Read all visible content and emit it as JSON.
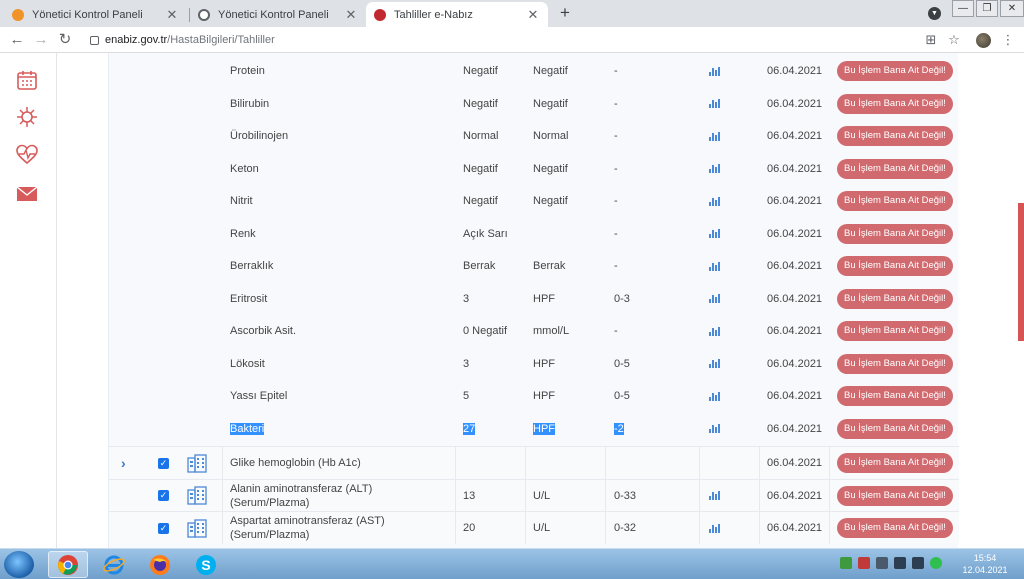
{
  "browser": {
    "tabs": [
      {
        "title": "Yönetici Kontrol Paneli",
        "active": false
      },
      {
        "title": "Yönetici Kontrol Paneli",
        "active": false
      },
      {
        "title": "Tahliller e-Nabız",
        "active": true
      }
    ],
    "url_host": "enabiz.gov.tr",
    "url_path": "/HastaBilgileri/Tahliller"
  },
  "sidebar": {
    "items": [
      {
        "icon": "calendar-icon"
      },
      {
        "icon": "virus-icon"
      },
      {
        "icon": "heart-pulse-icon"
      },
      {
        "icon": "mail-icon"
      }
    ]
  },
  "results": [
    {
      "name": "Protein",
      "value": "Negatif",
      "unit": "Negatif",
      "range": "-",
      "date": "06.04.2021",
      "action": "Bu İşlem Bana Ait Değil!"
    },
    {
      "name": "Bilirubin",
      "value": "Negatif",
      "unit": "Negatif",
      "range": "-",
      "date": "06.04.2021",
      "action": "Bu İşlem Bana Ait Değil!"
    },
    {
      "name": "Ürobilinojen",
      "value": "Normal",
      "unit": "Normal",
      "range": "-",
      "date": "06.04.2021",
      "action": "Bu İşlem Bana Ait Değil!"
    },
    {
      "name": "Keton",
      "value": "Negatif",
      "unit": "Negatif",
      "range": "-",
      "date": "06.04.2021",
      "action": "Bu İşlem Bana Ait Değil!"
    },
    {
      "name": "Nitrit",
      "value": "Negatif",
      "unit": "Negatif",
      "range": "-",
      "date": "06.04.2021",
      "action": "Bu İşlem Bana Ait Değil!"
    },
    {
      "name": "Renk",
      "value": "Açık Sarı",
      "unit": "",
      "range": "-",
      "date": "06.04.2021",
      "action": "Bu İşlem Bana Ait Değil!"
    },
    {
      "name": "Berraklık",
      "value": "Berrak",
      "unit": "Berrak",
      "range": "-",
      "date": "06.04.2021",
      "action": "Bu İşlem Bana Ait Değil!"
    },
    {
      "name": "Eritrosit",
      "value": "3",
      "unit": "HPF",
      "range": "0-3",
      "date": "06.04.2021",
      "action": "Bu İşlem Bana Ait Değil!"
    },
    {
      "name": "Ascorbik Asit.",
      "value": "0 Negatif",
      "unit": "mmol/L",
      "range": "-",
      "date": "06.04.2021",
      "action": "Bu İşlem Bana Ait Değil!"
    },
    {
      "name": "Lökosit",
      "value": "3",
      "unit": "HPF",
      "range": "0-5",
      "date": "06.04.2021",
      "action": "Bu İşlem Bana Ait Değil!"
    },
    {
      "name": "Yassı Epitel",
      "value": "5",
      "unit": "HPF",
      "range": "0-5",
      "date": "06.04.2021",
      "action": "Bu İşlem Bana Ait Değil!"
    },
    {
      "name": "Bakteri",
      "value": "27",
      "unit": "HPF",
      "range": "-2",
      "date": "06.04.2021",
      "action": "Bu İşlem Bana Ait Değil!",
      "selected": true
    }
  ],
  "tests": [
    {
      "name": "Glike hemoglobin (Hb A1c)",
      "value": "",
      "unit": "",
      "range": "",
      "date": "06.04.2021",
      "action": "Bu İşlem Bana Ait Değil!",
      "checked": true,
      "expand": true
    },
    {
      "name": "Alanin aminotransferaz (ALT) (Serum/Plazma)",
      "value": "13",
      "unit": "U/L",
      "range": "0-33",
      "date": "06.04.2021",
      "action": "Bu İşlem Bana Ait Değil!",
      "checked": true
    },
    {
      "name": "Aspartat aminotransferaz (AST) (Serum/Plazma)",
      "value": "20",
      "unit": "U/L",
      "range": "0-32",
      "date": "06.04.2021",
      "action": "Bu İşlem Bana Ait Değil!",
      "checked": true
    }
  ],
  "taskbar": {
    "time": "15:54",
    "date": "12.04.2021"
  }
}
